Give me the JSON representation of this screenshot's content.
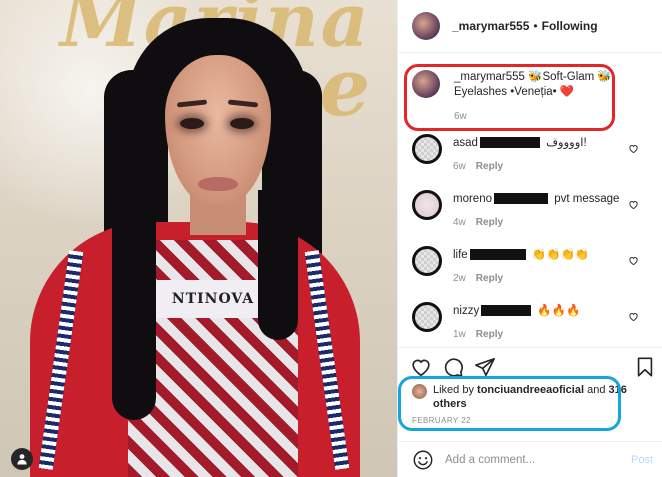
{
  "post": {
    "author": "_marymar555",
    "separator": "•",
    "follow_status": "Following"
  },
  "caption": {
    "username": "_marymar555",
    "text": "🐝Soft-Glam 🐝 Eyelashes •Veneția• ❤️",
    "age": "6w"
  },
  "comments": [
    {
      "username": "asad",
      "text": "اووووف!",
      "age": "6w",
      "reply_label": "Reply"
    },
    {
      "username": "moreno",
      "text": "pvt message",
      "age": "4w",
      "reply_label": "Reply"
    },
    {
      "username": "life",
      "text": "👏👏👏👏",
      "age": "2w",
      "reply_label": "Reply"
    },
    {
      "username": "nizzy",
      "text": "🔥🔥🔥",
      "age": "1w",
      "reply_label": "Reply"
    }
  ],
  "likes": {
    "prefix": "Liked by",
    "liker": "tonciuandreeaoficial",
    "conjunction": "and",
    "others": "316 others",
    "date": "FEBRUARY 22"
  },
  "compose": {
    "placeholder": "Add a comment...",
    "post_label": "Post"
  },
  "photo": {
    "wall_text_1": "Marina",
    "wall_text_2": "ke",
    "shirt_text": "NTINOVA"
  },
  "colors": {
    "highlight_red": "#e2262a",
    "highlight_blue": "#16a5dc",
    "post_button_disabled": "#b3dbff",
    "muted_text": "#8e8e8e"
  },
  "icons": {
    "user_tag": "user-tag-icon",
    "like": "heart-icon",
    "comment": "comment-icon",
    "share": "paper-plane-icon",
    "save": "bookmark-icon",
    "emoji": "smiley-icon"
  }
}
